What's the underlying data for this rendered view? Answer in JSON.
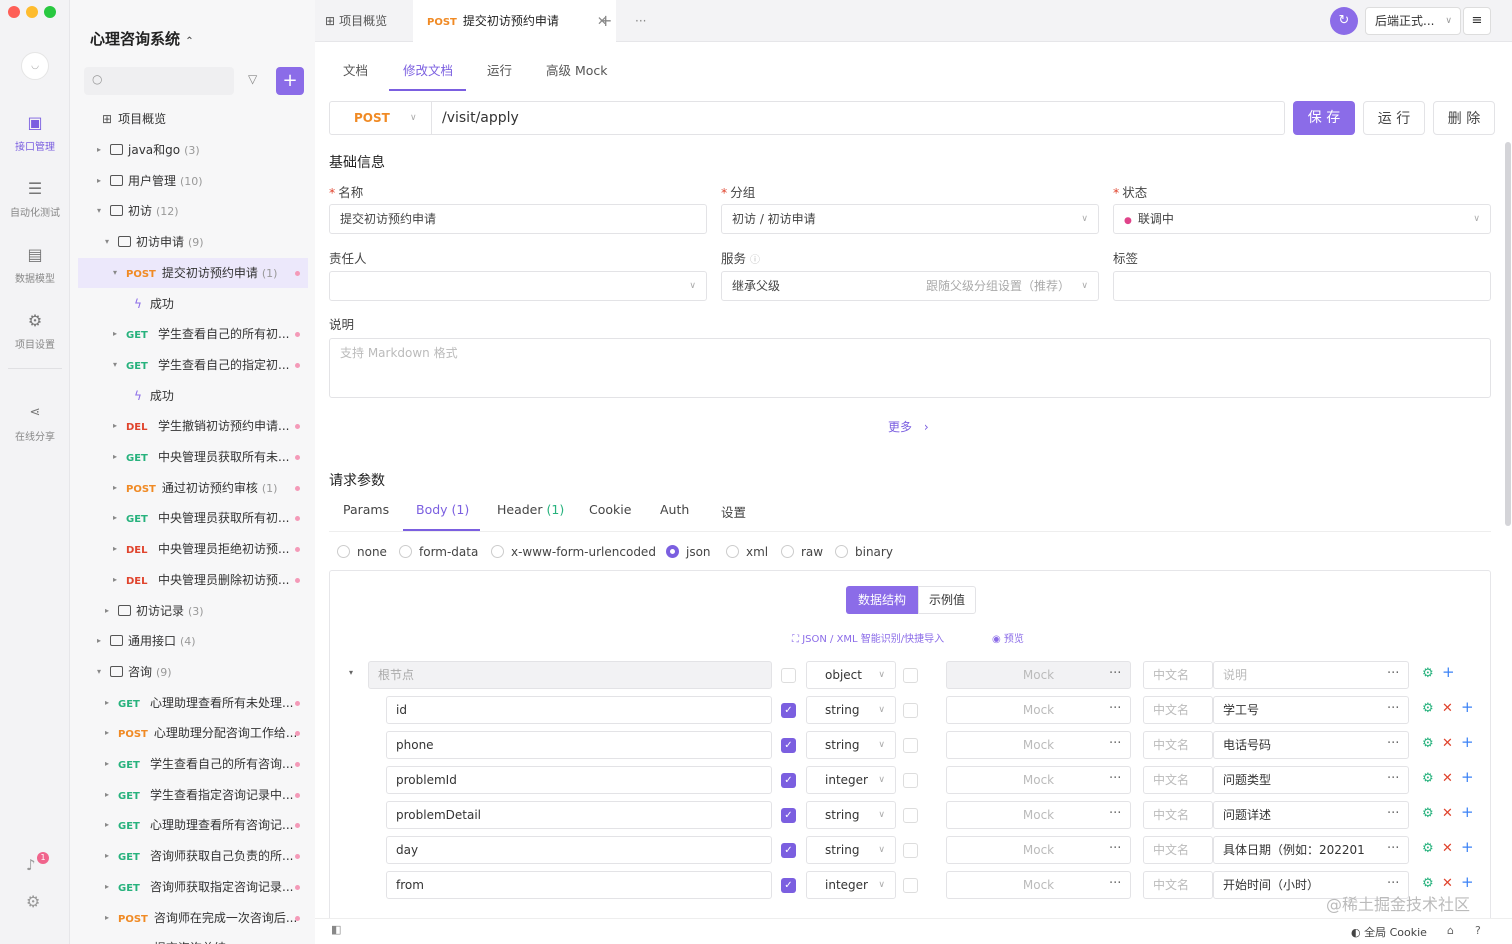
{
  "rail": {
    "items": [
      {
        "label": "接口管理"
      },
      {
        "label": "自动化测试"
      },
      {
        "label": "数据模型"
      },
      {
        "label": "项目设置"
      },
      {
        "label": "在线分享"
      }
    ],
    "badge": "1"
  },
  "tree": {
    "project": "心理咨询系统",
    "overview": "项目概览",
    "nodes": [
      {
        "label": "java和go",
        "count": "(3)"
      },
      {
        "label": "用户管理",
        "count": "(10)"
      },
      {
        "label": "初访",
        "count": "(12)"
      },
      {
        "label": "初访申请",
        "count": "(9)"
      },
      {
        "method": "POST",
        "label": "提交初访预约申请",
        "count": "(1)"
      },
      {
        "label": "成功"
      },
      {
        "method": "GET",
        "label": "学生查看自己的所有初..."
      },
      {
        "method": "GET",
        "label": "学生查看自己的指定初..."
      },
      {
        "label": "成功"
      },
      {
        "method": "DEL",
        "label": "学生撤销初访预约申请..."
      },
      {
        "method": "GET",
        "label": "中央管理员获取所有未..."
      },
      {
        "method": "POST",
        "label": "通过初访预约审核",
        "count": "(1)"
      },
      {
        "method": "GET",
        "label": "中央管理员获取所有初..."
      },
      {
        "method": "DEL",
        "label": "中央管理员拒绝初访预..."
      },
      {
        "method": "DEL",
        "label": "中央管理员删除初访预..."
      },
      {
        "label": "初访记录",
        "count": "(3)"
      },
      {
        "label": "通用接口",
        "count": "(4)"
      },
      {
        "label": "咨询",
        "count": "(9)"
      },
      {
        "method": "GET",
        "label": "心理助理查看所有未处理..."
      },
      {
        "method": "POST",
        "label": "心理助理分配咨询工作给..."
      },
      {
        "method": "GET",
        "label": "学生查看自己的所有咨询..."
      },
      {
        "method": "GET",
        "label": "学生查看指定咨询记录中..."
      },
      {
        "method": "GET",
        "label": "心理助理查看所有咨询记..."
      },
      {
        "method": "GET",
        "label": "咨询师获取自己负责的所..."
      },
      {
        "method": "GET",
        "label": "咨询师获取指定咨询记录..."
      },
      {
        "method": "POST",
        "label": "咨询师在完成一次咨询后..."
      },
      {
        "method": "POST",
        "label": "提交咨询总结"
      }
    ]
  },
  "tabs": {
    "overview": "项目概览",
    "active_method": "POST",
    "active_label": "提交初访预约申请",
    "env": "后端正式..."
  },
  "subtabs": [
    "文档",
    "修改文档",
    "运行",
    "高级 Mock"
  ],
  "request": {
    "method": "POST",
    "path": "/visit/apply",
    "save": "保 存",
    "run": "运 行",
    "delete": "删 除"
  },
  "basic": {
    "title": "基础信息",
    "name_label": "名称",
    "name_value": "提交初访预约申请",
    "group_label": "分组",
    "group_value": "初访 / 初访申请",
    "status_label": "状态",
    "status_value": "联调中",
    "owner_label": "责任人",
    "service_label": "服务",
    "service_value": "继承父级",
    "service_hint": "跟随父级分组设置（推荐）",
    "tag_label": "标签",
    "desc_label": "说明",
    "desc_placeholder": "支持 Markdown 格式",
    "more": "更多"
  },
  "params": {
    "title": "请求参数",
    "tabs": [
      "Params",
      "Body",
      "Header",
      "Cookie",
      "Auth",
      "设置"
    ],
    "body_count": "(1)",
    "header_count": "(1)",
    "body_types": [
      "none",
      "form-data",
      "x-www-form-urlencoded",
      "json",
      "xml",
      "raw",
      "binary"
    ],
    "seg_struct": "数据结构",
    "seg_example": "示例值",
    "import": "JSON / XML 智能识别/快捷导入",
    "preview": "预览",
    "root": {
      "name_placeholder": "根节点",
      "type": "object",
      "mock": "Mock",
      "cn_placeholder": "中文名",
      "desc_placeholder": "说明"
    },
    "fields": [
      {
        "name": "id",
        "type": "string",
        "desc": "学工号"
      },
      {
        "name": "phone",
        "type": "string",
        "desc": "电话号码"
      },
      {
        "name": "problemId",
        "type": "integer",
        "desc": "问题类型"
      },
      {
        "name": "problemDetail",
        "type": "string",
        "desc": "问题详述"
      },
      {
        "name": "day",
        "type": "string",
        "desc": "具体日期（例如：202201"
      },
      {
        "name": "from",
        "type": "integer",
        "desc": "开始时间（小时）"
      }
    ]
  },
  "footer": {
    "cookie": "全局 Cookie",
    "watermark": "@稀土掘金技术社区"
  },
  "colors": {
    "accent": "#7b5fe0",
    "get": "#27b27d",
    "post": "#f08a24",
    "del": "#e0442d"
  }
}
